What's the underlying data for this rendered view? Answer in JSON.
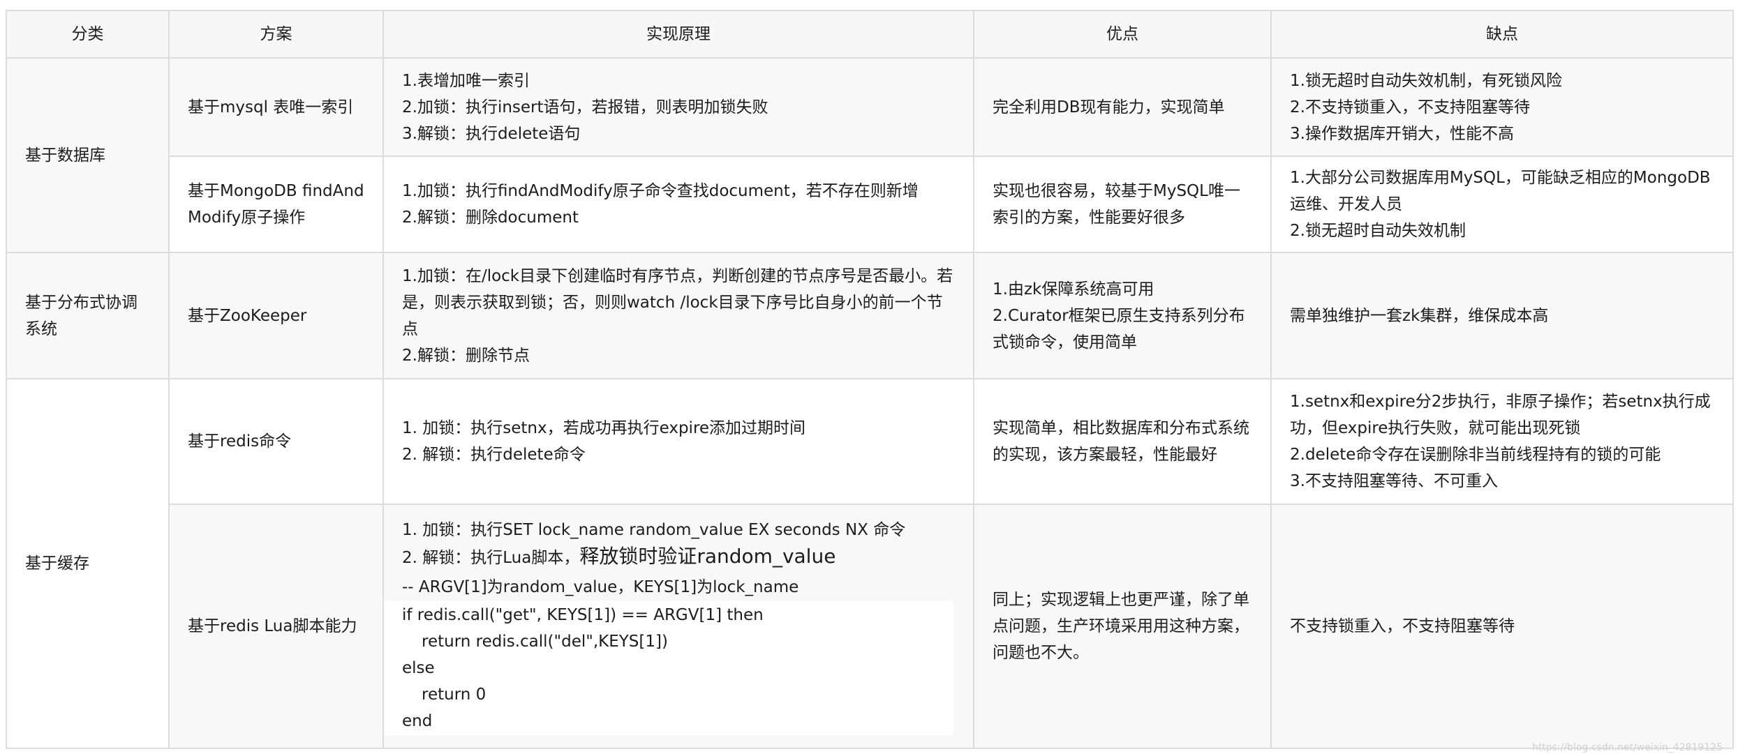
{
  "headers": [
    "分类",
    "方案",
    "实现原理",
    "优点",
    "缺点"
  ],
  "categories": {
    "db": "基于数据库",
    "zk": "基于分布式协调系统",
    "cache": "基于缓存"
  },
  "rows": [
    {
      "scheme": "基于mysql 表唯一索引",
      "principle": [
        "1.表增加唯一索引",
        "2.加锁：执行insert语句，若报错，则表明加锁失败",
        "3.解锁：执行delete语句"
      ],
      "pros": "完全利用DB现有能力，实现简单",
      "cons": [
        "1.锁无超时自动失效机制，有死锁风险",
        "2.不支持锁重入，不支持阻塞等待",
        "3.操作数据库开销大，性能不高"
      ]
    },
    {
      "scheme": "基于MongoDB findAndModify原子操作",
      "principle": [
        "1.加锁：执行findAndModify原子命令查找document，若不存在则新增",
        "2.解锁：删除document"
      ],
      "pros": "实现也很容易，较基于MySQL唯一索引的方案，性能要好很多",
      "cons": [
        "1.大部分公司数据库用MySQL，可能缺乏相应的MongoDB运维、开发人员",
        "2.锁无超时自动失效机制"
      ]
    },
    {
      "scheme": "基于ZooKeeper",
      "principle": [
        "1.加锁：在/lock目录下创建临时有序节点，判断创建的节点序号是否最小。若是，则表示获取到锁；否，则则watch /lock目录下序号比自身小的前一个节点",
        "2.解锁：删除节点"
      ],
      "pros": [
        "1.由zk保障系统高可用",
        "2.Curator框架已原生支持系列分布式锁命令，使用简单"
      ],
      "cons": "需单独维护一套zk集群，维保成本高"
    },
    {
      "scheme": "基于redis命令",
      "principle": [
        "1. 加锁：执行setnx，若成功再执行expire添加过期时间",
        "2. 解锁：执行delete命令"
      ],
      "pros": "实现简单，相比数据库和分布式系统的实现，该方案最轻，性能最好",
      "cons": [
        "1.setnx和expire分2步执行，非原子操作；若setnx执行成功，但expire执行失败，就可能出现死锁",
        "2.delete命令存在误删除非当前线程持有的锁的可能",
        "3.不支持阻塞等待、不可重入"
      ]
    },
    {
      "scheme": "基于redis Lua脚本能力",
      "principle_lines": [
        "1. 加锁：执行SET lock_name random_value EX seconds NX 命令",
        "2. 解锁：执行Lua脚本，"
      ],
      "principle_big": "释放锁时验证random_value",
      "principle_comment": "-- ARGV[1]为random_value，KEYS[1]为lock_name",
      "code": [
        "if redis.call(\"get\", KEYS[1]) == ARGV[1] then",
        "return redis.call(\"del\",KEYS[1])",
        "else",
        "return 0",
        "end"
      ],
      "pros": "同上；实现逻辑上也更严谨，除了单点问题，生产环境采用用这种方案，问题也不大。",
      "cons": "不支持锁重入，不支持阻塞等待"
    }
  ],
  "watermark": "https://blog.csdn.net/weixin_42819125"
}
